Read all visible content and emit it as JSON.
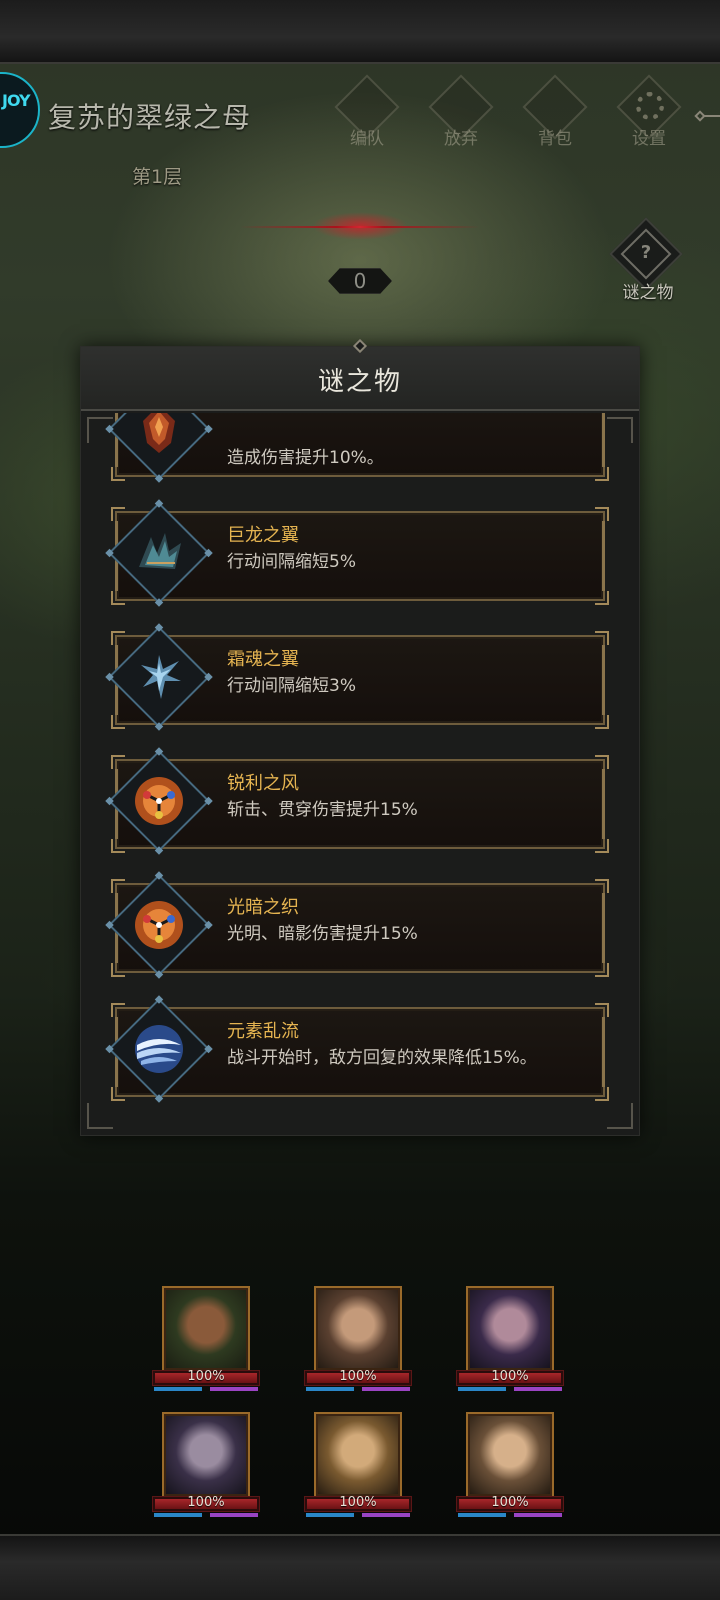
{
  "header": {
    "logo_text": "JOY",
    "stage_title": "复苏的翠绿之母",
    "floor": "第1层",
    "menu": [
      {
        "label": "编队",
        "icon": "formation-icon"
      },
      {
        "label": "放弃",
        "icon": "abandon-icon"
      },
      {
        "label": "背包",
        "icon": "backpack-icon"
      },
      {
        "label": "设置",
        "icon": "gear-icon"
      }
    ],
    "counter": "0",
    "mystery_button": {
      "symbol": "?",
      "label": "谜之物"
    }
  },
  "panel": {
    "title": "谜之物",
    "items": [
      {
        "name": "",
        "desc": "造成伤害提升10%。",
        "icon": "red-crystal-icon"
      },
      {
        "name": "巨龙之翼",
        "desc": "行动间隔缩短5%",
        "icon": "dragon-wing-icon"
      },
      {
        "name": "霜魂之翼",
        "desc": "行动间隔缩短3%",
        "icon": "frost-wing-icon"
      },
      {
        "name": "锐利之风",
        "desc": "斩击、贯穿伤害提升15%",
        "icon": "triad-orb-icon"
      },
      {
        "name": "光暗之织",
        "desc": "光明、暗影伤害提升15%",
        "icon": "triad-orb-icon"
      },
      {
        "name": "元素乱流",
        "desc": "战斗开始时，敌方回复的效果降低15%。",
        "icon": "element-swirl-icon"
      }
    ]
  },
  "party": [
    {
      "hp": "100%",
      "hp_fraction": 1.0
    },
    {
      "hp": "100%",
      "hp_fraction": 1.0
    },
    {
      "hp": "100%",
      "hp_fraction": 1.0
    },
    {
      "hp": "100%",
      "hp_fraction": 1.0
    },
    {
      "hp": "100%",
      "hp_fraction": 1.0
    },
    {
      "hp": "100%",
      "hp_fraction": 1.0
    }
  ],
  "colors": {
    "item_name": "#e5b451",
    "item_desc": "#cfcac0",
    "item_border": "#6e5c3c",
    "hp_bar": "#a8262a",
    "mp_bar": "#2a86c7",
    "sp_bar": "#9a44c3"
  }
}
